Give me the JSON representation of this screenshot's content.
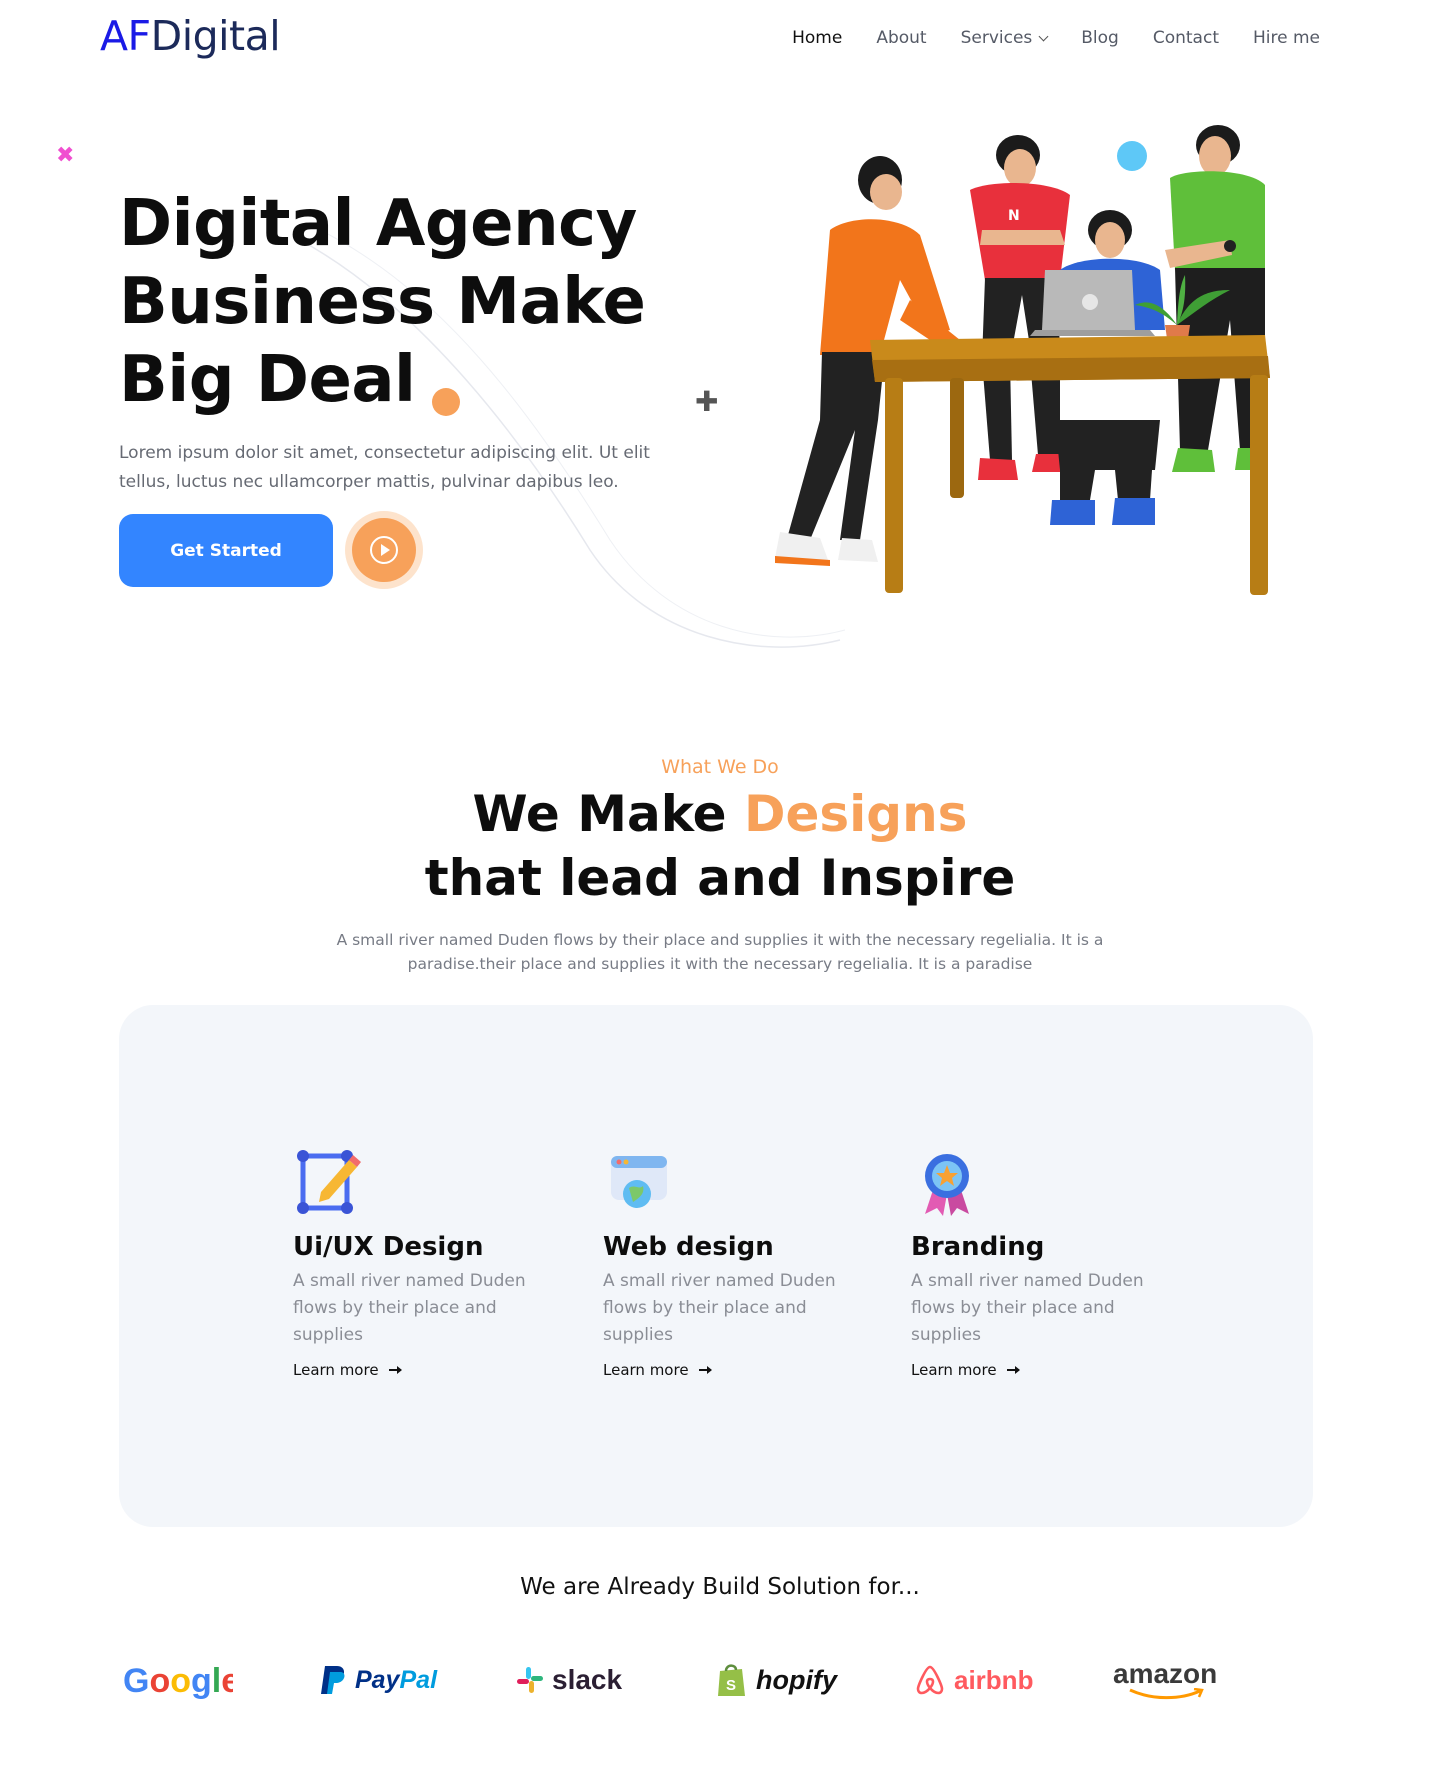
{
  "brand": {
    "part1": "AF",
    "part2": "Digital"
  },
  "nav": {
    "items": [
      {
        "label": "Home",
        "active": true
      },
      {
        "label": "About",
        "active": false
      },
      {
        "label": "Services",
        "active": false,
        "dropdown": true
      },
      {
        "label": "Blog",
        "active": false
      },
      {
        "label": "Contact",
        "active": false
      },
      {
        "label": "Hire me",
        "active": false
      }
    ]
  },
  "hero": {
    "title_lines": [
      "Digital Agency",
      "Business Make",
      "Big Deal"
    ],
    "text": "Lorem ipsum dolor sit amet, consectetur adipiscing elit. Ut elit tellus, luctus nec ullamcorper mattis, pulvinar dapibus leo.",
    "cta_label": "Get Started",
    "play_icon": "play-circle-icon"
  },
  "services": {
    "kicker": "What We Do",
    "title_line1_a": "We Make ",
    "title_line1_accent": "Designs",
    "title_line2": "that lead and Inspire",
    "subtitle": "A small river named Duden flows by their place and supplies it with the necessary regelialia. It is a paradise.their place and supplies it with the necessary regelialia. It is a paradise",
    "cards": [
      {
        "icon": "design-pencil-icon",
        "title": "Ui/UX Design",
        "text": "A small river named Duden flows by their place and supplies",
        "link": "Learn more"
      },
      {
        "icon": "web-browser-globe-icon",
        "title": "Web design",
        "text": "A small river named Duden flows by their place and supplies",
        "link": "Learn more"
      },
      {
        "icon": "award-badge-icon",
        "title": "Branding",
        "text": "A small river named Duden flows by their place and supplies",
        "link": "Learn more"
      }
    ]
  },
  "clients": {
    "title": "We are Already Build Solution for...",
    "logos": [
      "Google",
      "PayPal",
      "slack",
      "hopify",
      "airbnb",
      "amazon"
    ]
  },
  "colors": {
    "accent_orange": "#f7a15a",
    "primary_blue": "#3385ff",
    "panel_bg": "#f3f6fa",
    "brand_blue": "#1a1ae6"
  }
}
